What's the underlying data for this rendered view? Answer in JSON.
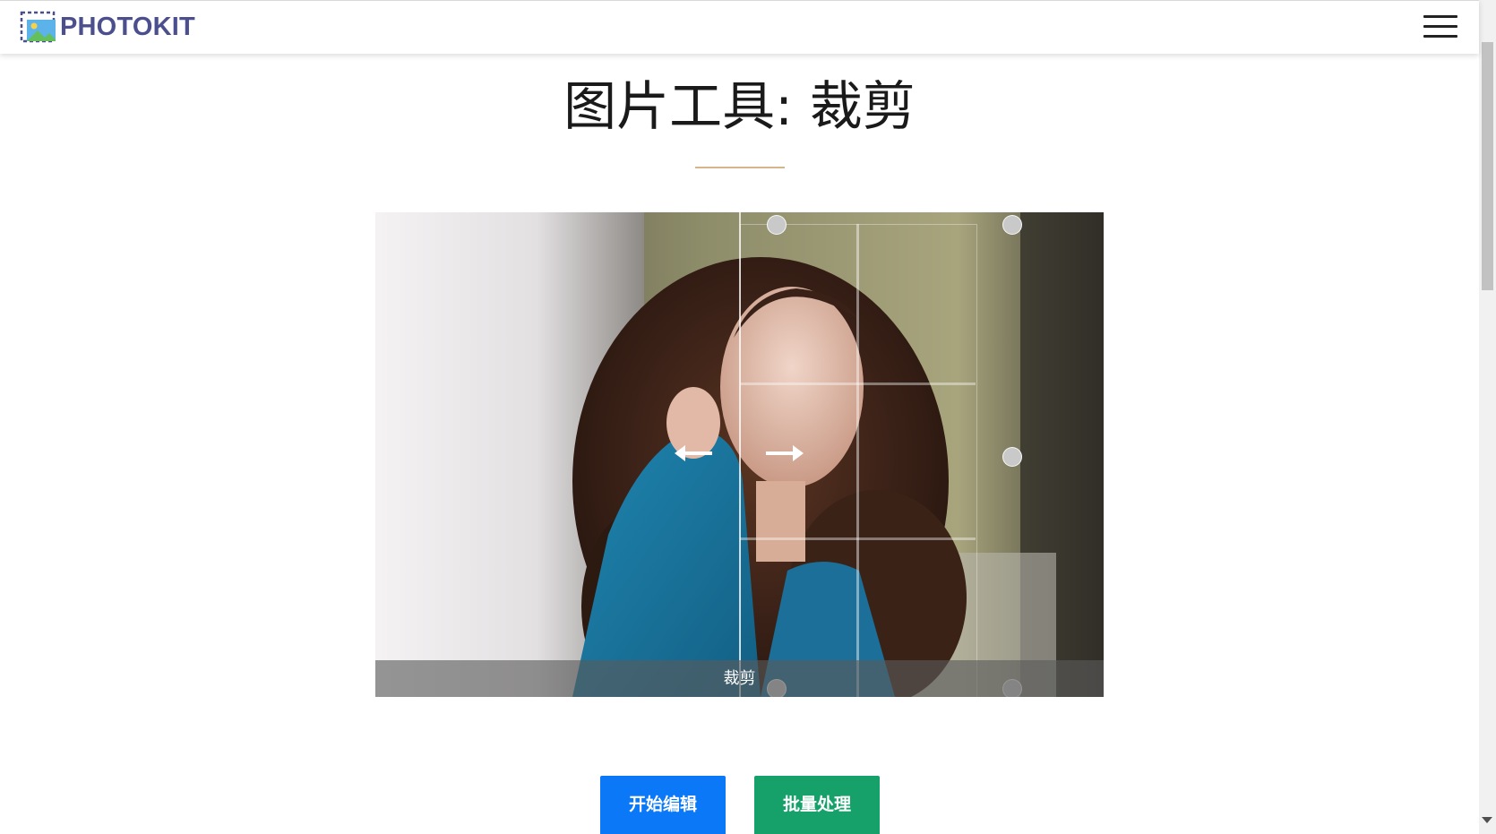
{
  "header": {
    "brand_name": "PHOTOKIT",
    "logo_icon": "photo-frame-icon",
    "menu_icon": "hamburger-menu-icon"
  },
  "main": {
    "title": "图片工具: 裁剪",
    "demo_caption": "裁剪",
    "buttons": {
      "edit_label": "开始编辑",
      "batch_label": "批量处理"
    }
  },
  "colors": {
    "brand": "#4b4f8e",
    "accent_rule": "#d7b58c",
    "edit_button": "#0b79f7",
    "batch_button": "#16a06a"
  }
}
